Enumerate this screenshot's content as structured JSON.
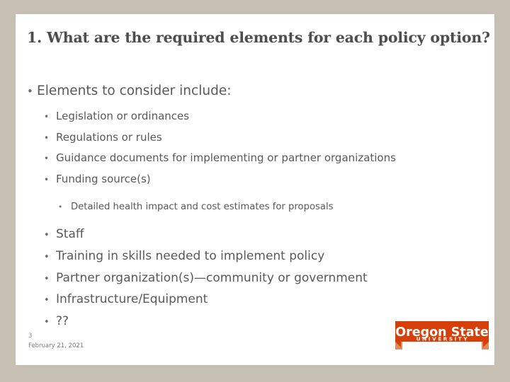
{
  "slide": {
    "title": "1. What are the required elements for each policy option?",
    "bullets": [
      {
        "level": 1,
        "marker": "•",
        "text": "Elements to consider include:"
      },
      {
        "level": "2s",
        "marker": "•",
        "text": "Legislation or ordinances"
      },
      {
        "level": "2s",
        "marker": "•",
        "text": "Regulations or rules"
      },
      {
        "level": "2s",
        "marker": "•",
        "text": "Guidance documents for implementing or partner organizations"
      },
      {
        "level": "2s",
        "marker": "•",
        "text": "Funding source(s)"
      },
      {
        "level": 3,
        "marker": "•",
        "text": "Detailed health impact and cost estimates for proposals"
      },
      {
        "level": "2b",
        "marker": "•",
        "text": "Staff"
      },
      {
        "level": "2b",
        "marker": "•",
        "text": "Training in skills needed to implement policy"
      },
      {
        "level": "2b",
        "marker": "•",
        "text": "Partner organization(s)—community or government"
      },
      {
        "level": "2b",
        "marker": "•",
        "text": "Infrastructure/Equipment"
      },
      {
        "level": "2b",
        "marker": "•",
        "text": "??"
      }
    ],
    "footer": {
      "slide_number": "3",
      "date": "February 21, 2021"
    },
    "logo": {
      "line1": "Oregon State",
      "line2": "UNIVERSITY"
    },
    "colors": {
      "frame": "#c5bfb4",
      "slide_background": "#ffffff",
      "title_text": "#4d4d4d",
      "body_text": "#595959",
      "footer_text": "#7f7f7f",
      "logo_banner": "#d73f09",
      "logo_fold": "#e08b5f"
    }
  }
}
